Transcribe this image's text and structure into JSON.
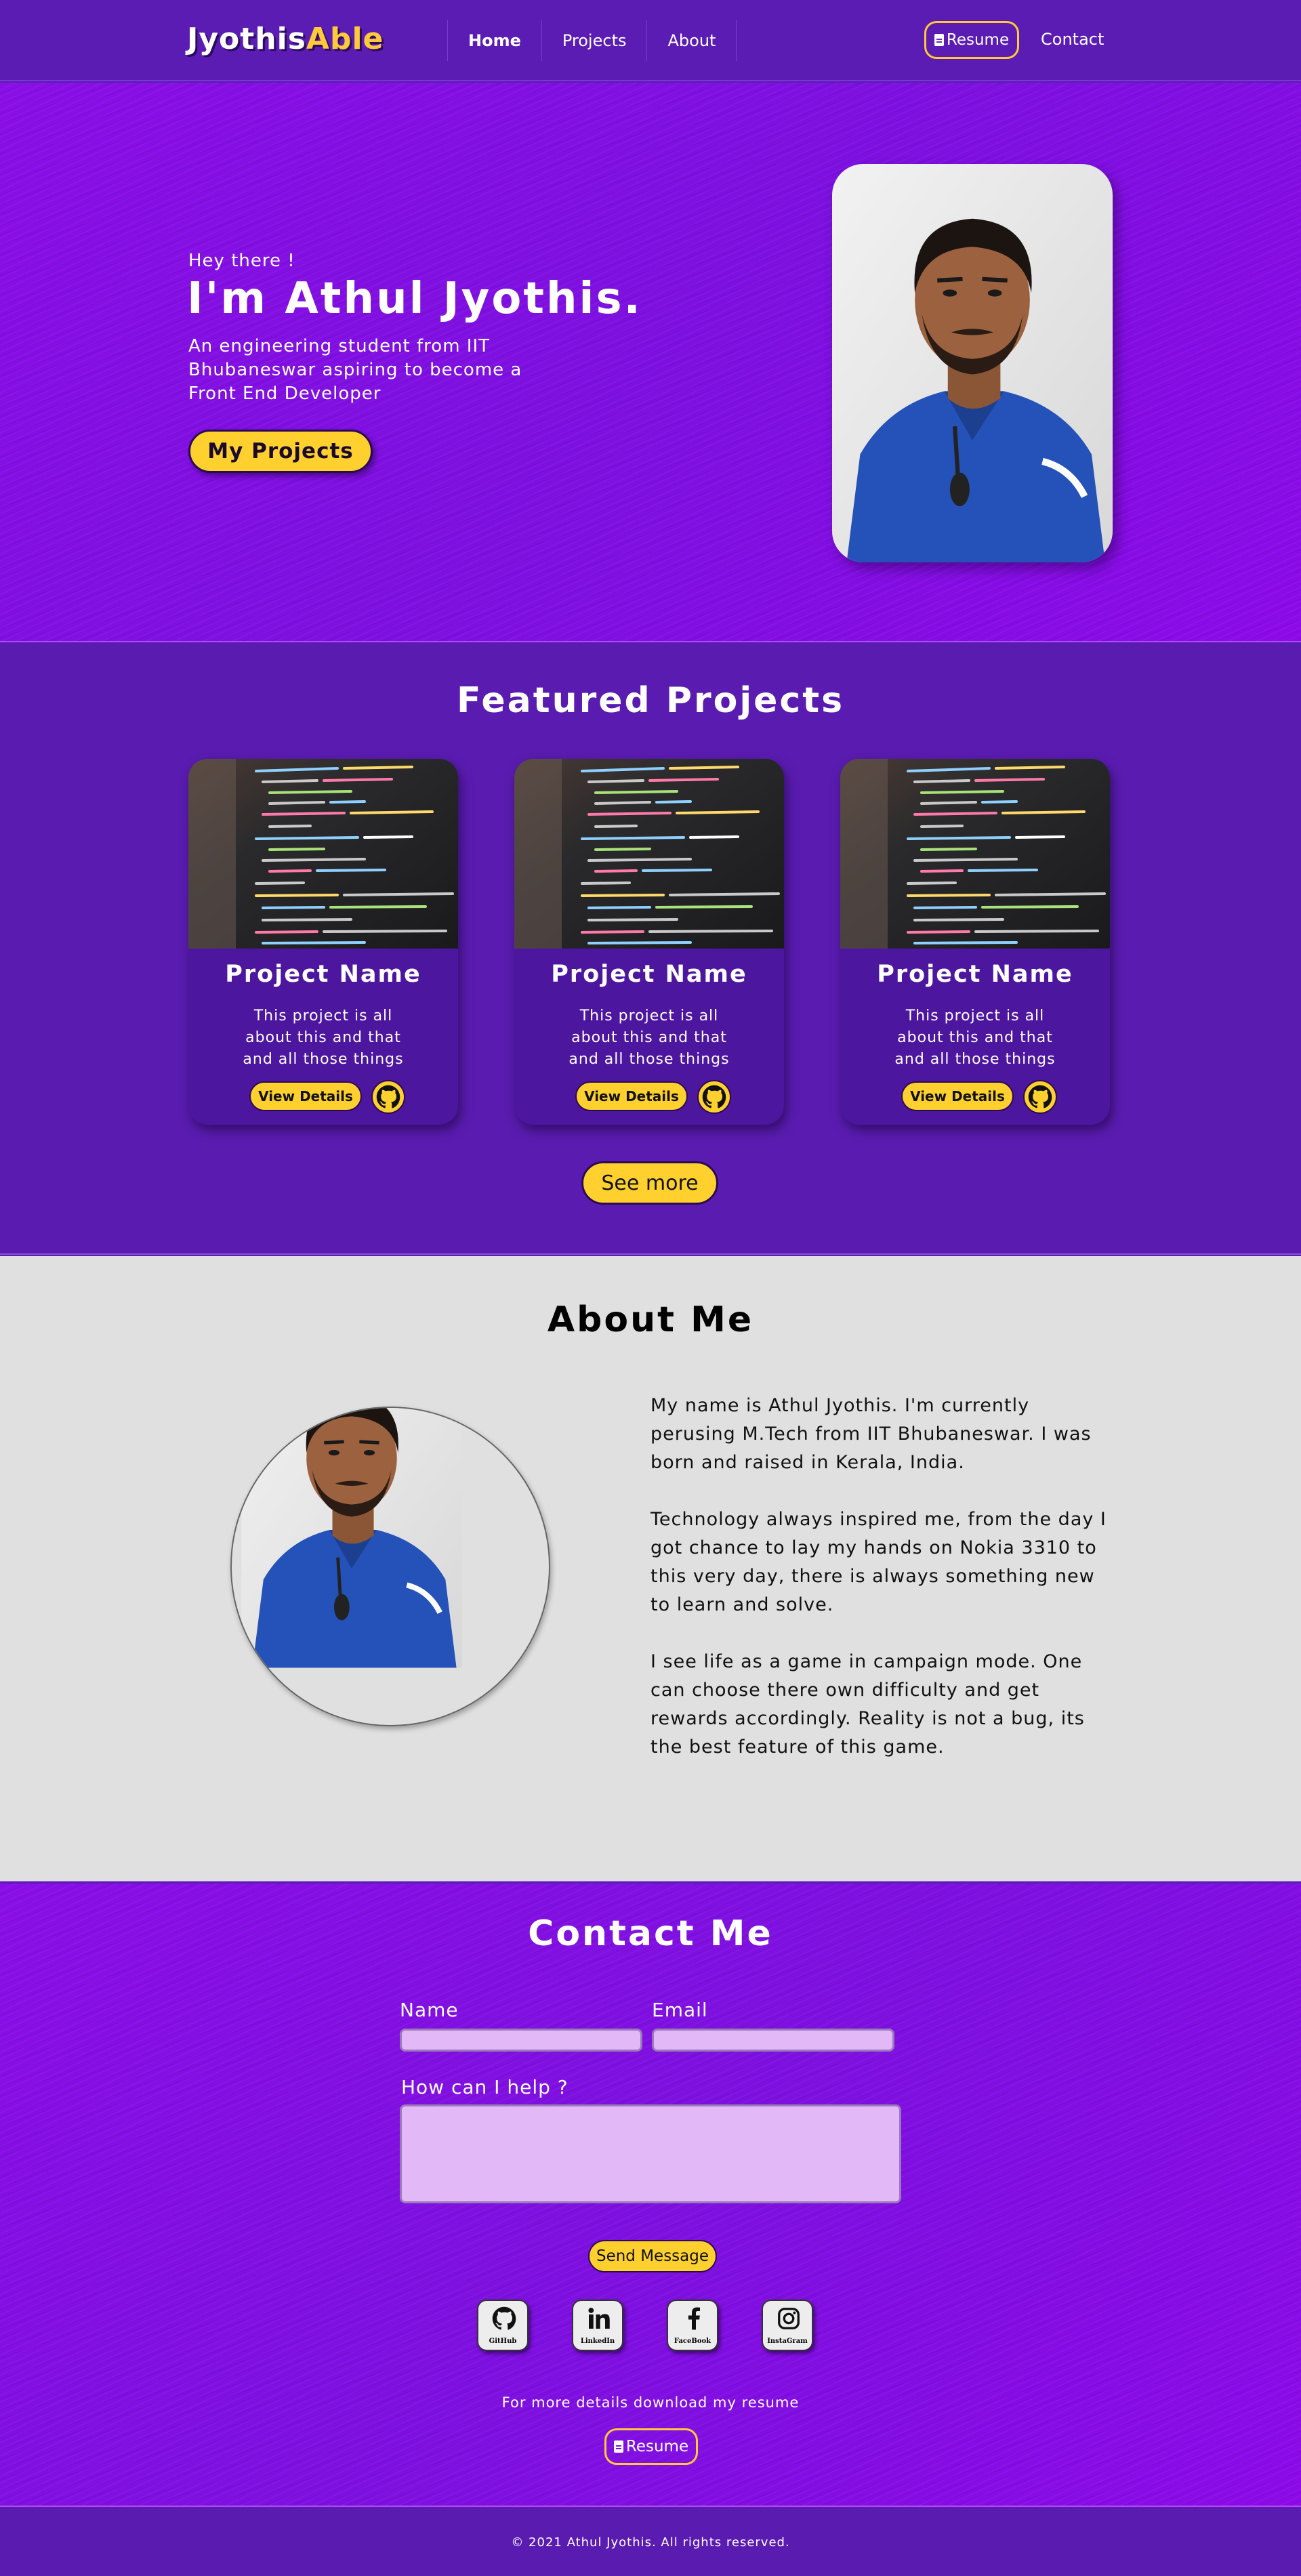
{
  "nav": {
    "logo_part1": "Jyothis",
    "logo_part2": "Able",
    "links": [
      {
        "label": "Home"
      },
      {
        "label": "Projects"
      },
      {
        "label": "About"
      }
    ],
    "resume_label": "Resume",
    "contact_label": "Contact",
    "accent_color": "#ffc93a"
  },
  "hero": {
    "greeting": "Hey there !",
    "name": "I'm Athul Jyothis.",
    "description": "An engineering student from IIT Bhubaneswar aspiring to become a Front End Developer",
    "button_label": "My Projects"
  },
  "projects": {
    "title": "Featured Projects",
    "cards": [
      {
        "title": "Project Name",
        "description": "This project is all about this and that and all those things",
        "button_label": "View Details"
      },
      {
        "title": "Project Name",
        "description": "This project is all about this and that and all those things",
        "button_label": "View Details"
      },
      {
        "title": "Project Name",
        "description": "This project is all about this and that and all those things",
        "button_label": "View Details"
      }
    ],
    "see_more_label": "See more"
  },
  "about": {
    "title": "About Me",
    "paragraphs": [
      "My name is Athul Jyothis. I'm currently perusing M.Tech from IIT Bhubaneswar. I was born and raised in Kerala, India.",
      "Technology always inspired me, from the day I got chance to lay my hands on Nokia 3310 to this very day, there is always something new to learn and solve.",
      "I see life as a game in campaign mode. One can choose there own difficulty and get rewards accordingly. Reality is not a bug, its the best feature of this game."
    ]
  },
  "contact": {
    "title": "Contact Me",
    "name_label": "Name",
    "email_label": "Email",
    "message_label": "How can I help ?",
    "send_label": "Send Message",
    "socials": [
      {
        "label": "GitHub",
        "icon": "github-icon"
      },
      {
        "label": "LinkedIn",
        "icon": "linkedin-icon"
      },
      {
        "label": "FaceBook",
        "icon": "facebook-icon"
      },
      {
        "label": "InstaGram",
        "icon": "instagram-icon"
      }
    ],
    "note": "For more details download my resume",
    "resume_label": "Resume"
  },
  "footer": {
    "text": "© 2021 Athul Jyothis. All rights reserved."
  }
}
